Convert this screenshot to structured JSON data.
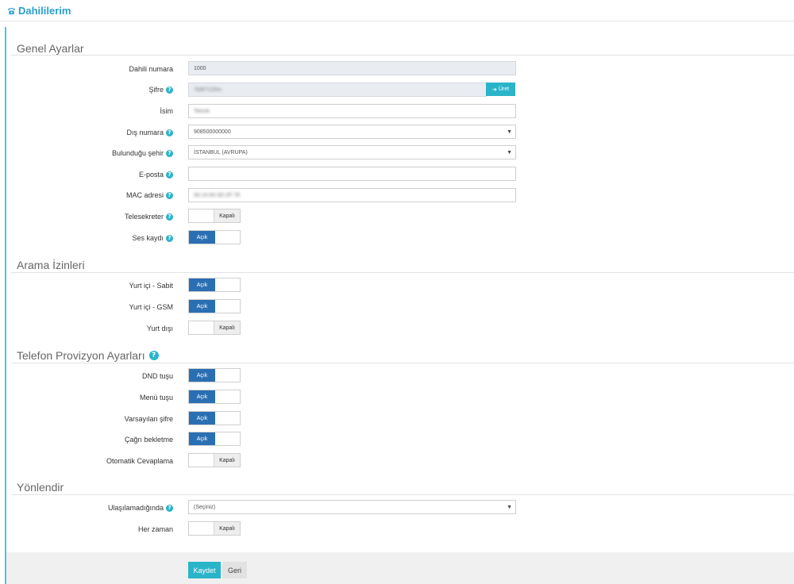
{
  "page": {
    "title": "Dahililerim",
    "icon": "phone-icon"
  },
  "sections": {
    "general": "Genel Ayarlar",
    "permissions": "Arama İzinleri",
    "provisioning": "Telefon Provizyon Ayarları",
    "redirect": "Yönlendir"
  },
  "general": {
    "extension_label": "Dahili numara",
    "extension_value": "1000",
    "password_label": "Şifre",
    "password_value": "7b9f7120m",
    "generate_label": "Üret",
    "name_label": "İsim",
    "name_value": "Teknik",
    "external_label": "Dış numara",
    "external_value": "908500000000",
    "city_label": "Bulunduğu şehir",
    "city_value": "İSTANBUL (AVRUPA)",
    "email_label": "E-posta",
    "email_value": "",
    "mac_label": "MAC adresi",
    "mac_value": "00:15:65:3D:2F:7E",
    "voicemail_label": "Telesekreter",
    "voicemail_state": "Kapalı",
    "recording_label": "Ses kaydı",
    "recording_state": "Açık"
  },
  "permissions": {
    "landline_label": "Yurt içi - Sabit",
    "landline_state": "Açık",
    "gsm_label": "Yurt içi - GSM",
    "gsm_state": "Açık",
    "intl_label": "Yurt dışı",
    "intl_state": "Kapalı"
  },
  "provisioning": {
    "dnd_label": "DND tuşu",
    "dnd_state": "Açık",
    "menu_label": "Menü tuşu",
    "menu_state": "Açık",
    "defpass_label": "Varsayılan şifre",
    "defpass_state": "Açık",
    "callwait_label": "Çağrı bekletme",
    "callwait_state": "Açık",
    "autoanswer_label": "Otomatik Cevaplama",
    "autoanswer_state": "Kapalı"
  },
  "redirect": {
    "unreachable_label": "Ulaşılamadığında",
    "unreachable_value": "(Seçiniz)",
    "always_label": "Her zaman",
    "always_state": "Kapalı"
  },
  "footer": {
    "save_label": "Kaydet",
    "back_label": "Geri"
  },
  "colors": {
    "accent": "#2ab4c9",
    "toggle_on": "#2b6fb3",
    "title": "#2a9fd0"
  }
}
